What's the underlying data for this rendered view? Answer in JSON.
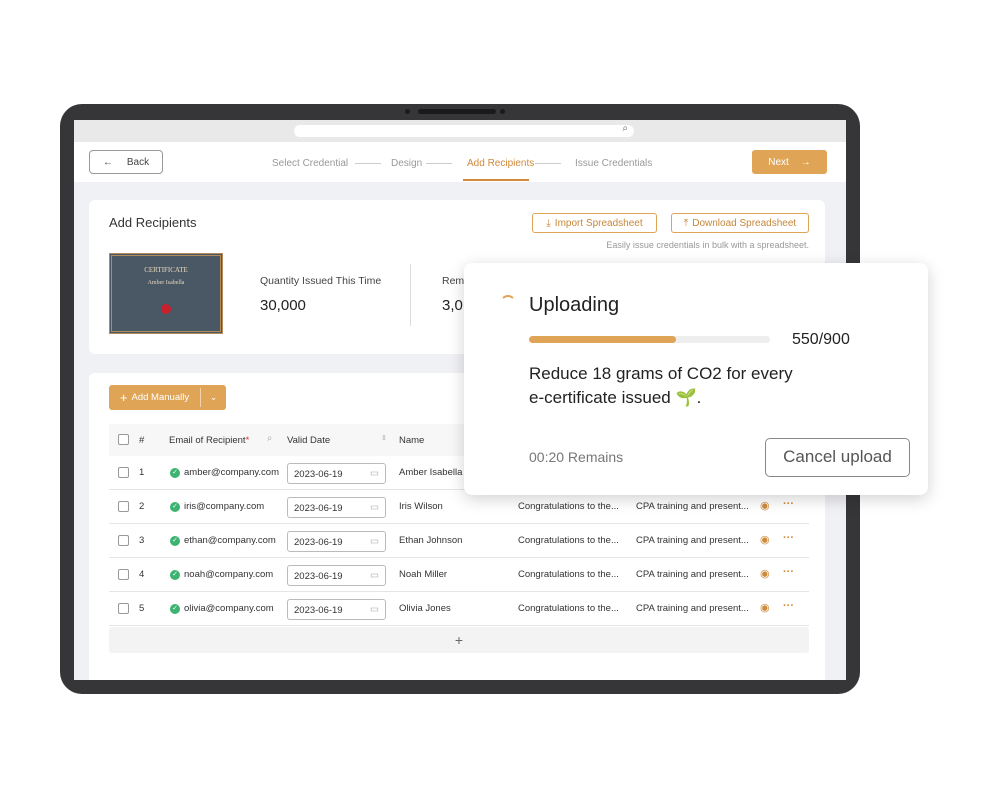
{
  "header": {
    "back": "Back",
    "steps": [
      "Select Credential",
      "Design",
      "Add Recipients",
      "Issue Credentials"
    ],
    "active_step": 2,
    "next": "Next"
  },
  "recipients_card": {
    "title": "Add Recipients",
    "import": "Import Spreadsheet",
    "download": "Download Spreadsheet",
    "hint": "Easily issue credentials in bulk with a spreadsheet.",
    "certificate": {
      "title": "CERTIFICATE",
      "name": "Amber Isabella"
    },
    "quantity_label": "Quantity Issued This Time",
    "quantity": "30,000",
    "remaining_label": "Rema",
    "remaining": "3,0"
  },
  "table": {
    "add_manually": "Add Manually",
    "columns": [
      "#",
      "Email of Recipient",
      "Valid Date",
      "Name"
    ],
    "rows": [
      {
        "n": "1",
        "email": "amber@company.com",
        "date": "2023-06-19",
        "name": "Amber Isabella",
        "msg": "",
        "desc": ""
      },
      {
        "n": "2",
        "email": "iris@company.com",
        "date": "2023-06-19",
        "name": "Iris Wilson",
        "msg": "Congratulations to the...",
        "desc": "CPA training and present..."
      },
      {
        "n": "3",
        "email": "ethan@company.com",
        "date": "2023-06-19",
        "name": "Ethan Johnson",
        "msg": "Congratulations to the...",
        "desc": "CPA training and present..."
      },
      {
        "n": "4",
        "email": "noah@company.com",
        "date": "2023-06-19",
        "name": "Noah Miller",
        "msg": "Congratulations to the...",
        "desc": "CPA training and present..."
      },
      {
        "n": "5",
        "email": "olivia@company.com",
        "date": "2023-06-19",
        "name": "Olivia Jones",
        "msg": "Congratulations to the...",
        "desc": "CPA training and present..."
      }
    ],
    "add_row": "+"
  },
  "upload": {
    "title": "Uploading",
    "progress": 550,
    "total": 900,
    "progress_text": "550/900",
    "message": "Reduce 18 grams of CO2 for every e-certificate issued 🌱.",
    "remaining": "00:20 Remains",
    "cancel": "Cancel upload"
  },
  "colors": {
    "accent": "#e0a456",
    "success": "#3cb371"
  }
}
